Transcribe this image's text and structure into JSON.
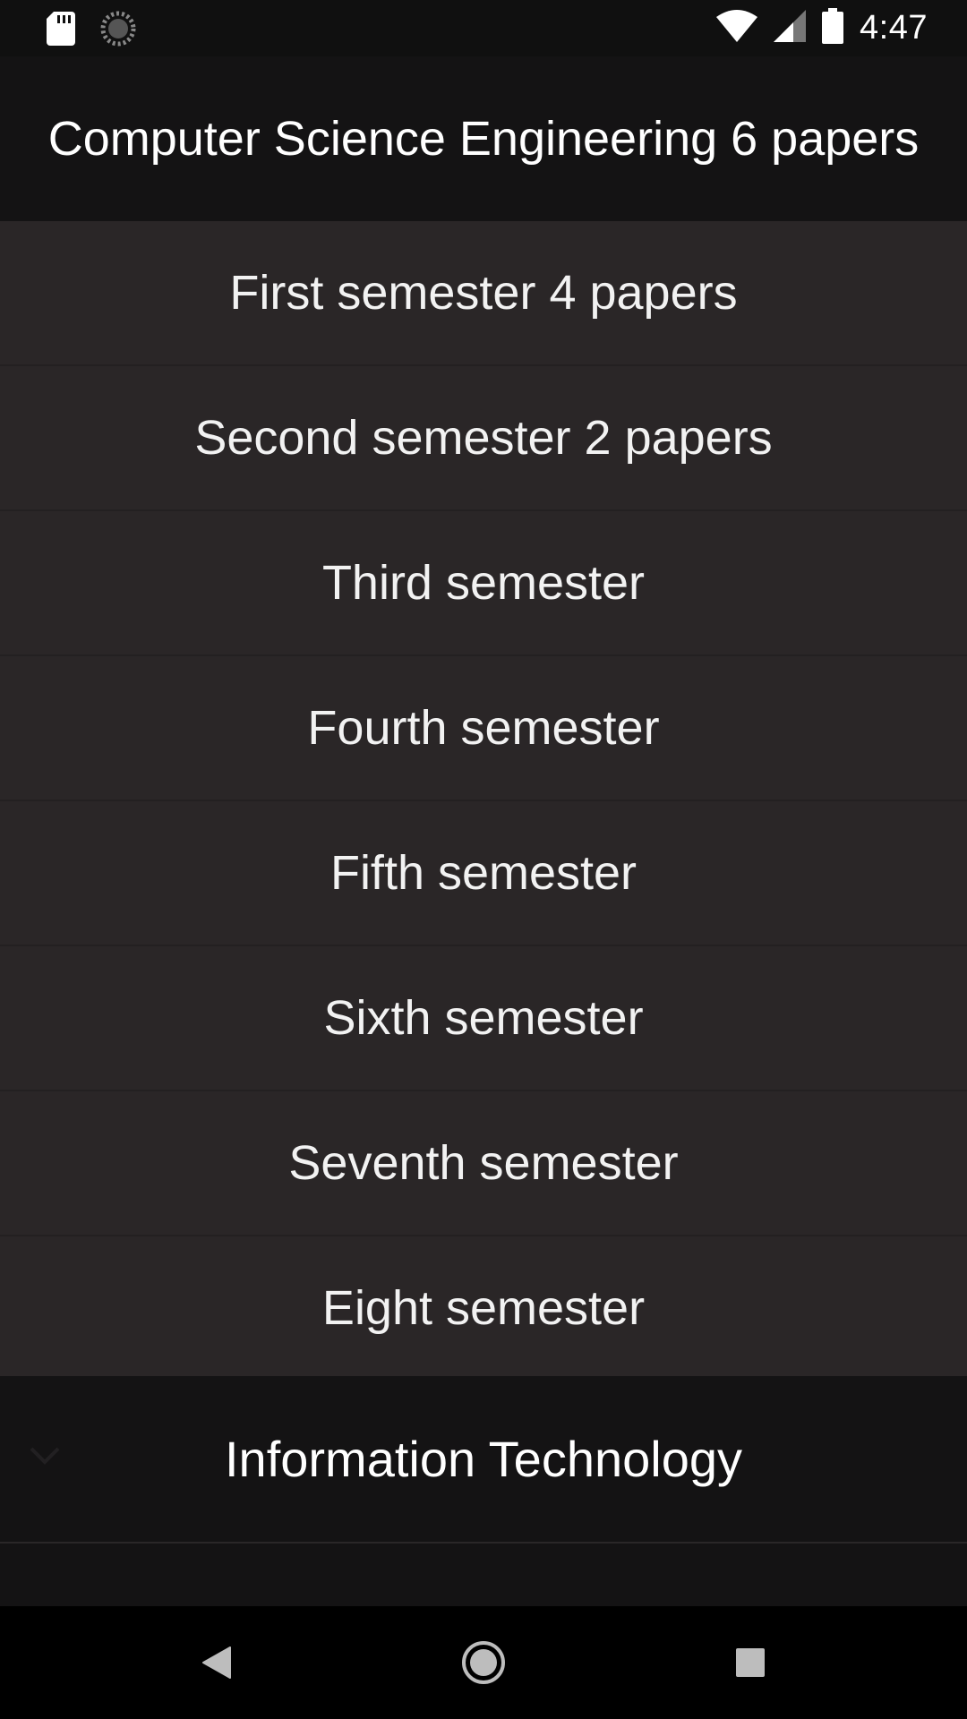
{
  "status_bar": {
    "time": "4:47",
    "icons": [
      "sd-card-icon",
      "sync-icon",
      "wifi-icon",
      "signal-icon",
      "battery-icon"
    ]
  },
  "header": {
    "title": "Computer Science Engineering 6 papers"
  },
  "semesters": [
    {
      "label": "First semester 4 papers"
    },
    {
      "label": "Second semester 2 papers"
    },
    {
      "label": "Third semester"
    },
    {
      "label": "Fourth semester"
    },
    {
      "label": "Fifth semester"
    },
    {
      "label": "Sixth semester"
    },
    {
      "label": "Seventh semester"
    },
    {
      "label": "Eight semester"
    }
  ],
  "group": {
    "label": "Information Technology",
    "icon": "chevron-down-icon"
  },
  "nav": {
    "buttons": [
      "back-icon",
      "home-icon",
      "recents-icon"
    ]
  },
  "colors": {
    "background": "#141314",
    "item_background": "#2a2627",
    "text": "#f2f2f2"
  }
}
